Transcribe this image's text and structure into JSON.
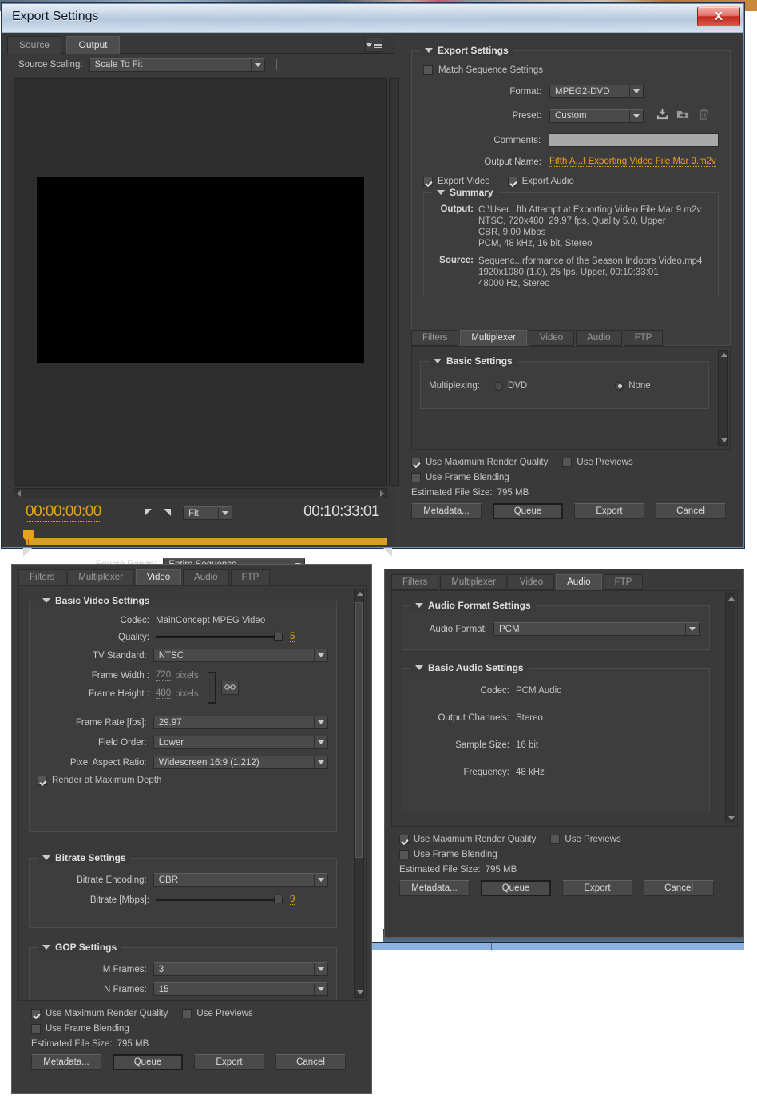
{
  "window": {
    "title": "Export Settings",
    "close_label": "X"
  },
  "left_panel": {
    "tabs": [
      {
        "label": "Source",
        "active": false
      },
      {
        "label": "Output",
        "active": true
      }
    ],
    "panel_menu_icon": "panel-menu-icon",
    "source_scaling_label": "Source Scaling:",
    "source_scaling_value": "Scale To Fit",
    "current_timecode": "00:00:00:00",
    "duration_timecode": "00:10:33:01",
    "zoom_level": "Fit",
    "source_range_label": "Source Range:",
    "source_range_value": "Entire Sequence"
  },
  "export_settings": {
    "group_title": "Export Settings",
    "match_sequence_label": "Match Sequence Settings",
    "match_sequence_checked": false,
    "format_label": "Format:",
    "format_value": "MPEG2-DVD",
    "preset_label": "Preset:",
    "preset_value": "Custom",
    "preset_icons": [
      "save-preset-icon",
      "import-preset-icon",
      "delete-preset-icon"
    ],
    "comments_label": "Comments:",
    "comments_value": "",
    "output_name_label": "Output Name:",
    "output_name_value": "Fifth A...t Exporting Video File Mar 9.m2v",
    "output_name_color": "#e8a317",
    "export_video_label": "Export Video",
    "export_video_checked": true,
    "export_audio_label": "Export Audio",
    "export_audio_checked": true
  },
  "summary": {
    "group_title": "Summary",
    "output_key": "Output:",
    "output_lines": [
      "C:\\User...fth Attempt at Exporting Video File Mar 9.m2v",
      "NTSC, 720x480, 29.97 fps, Quality 5.0, Upper",
      "CBR, 9.00 Mbps",
      "PCM, 48 kHz, 16 bit, Stereo"
    ],
    "source_key": "Source:",
    "source_lines": [
      "Sequenc...rformance of the Season Indoors Video.mp4",
      "1920x1080 (1.0), 25 fps, Upper, 00:10:33:01",
      "48000 Hz, Stereo"
    ]
  },
  "main_tabs": [
    {
      "label": "Filters",
      "active": false
    },
    {
      "label": "Multiplexer",
      "active": true
    },
    {
      "label": "Video",
      "active": false
    },
    {
      "label": "Audio",
      "active": false
    },
    {
      "label": "FTP",
      "active": false
    }
  ],
  "multiplexer": {
    "group_title": "Basic Settings",
    "multiplexing_label": "Multiplexing:",
    "option_dvd": "DVD",
    "option_dvd_selected": false,
    "option_none": "None",
    "option_none_selected": true
  },
  "footer": {
    "max_render_quality_label": "Use Maximum Render Quality",
    "max_render_quality_checked": true,
    "use_previews_label": "Use Previews",
    "use_previews_checked": false,
    "frame_blending_label": "Use Frame Blending",
    "frame_blending_checked": false,
    "estimated_size_label": "Estimated File Size:",
    "estimated_size_value": "795 MB",
    "buttons": [
      {
        "label": "Metadata...",
        "default": false
      },
      {
        "label": "Queue",
        "default": true
      },
      {
        "label": "Export",
        "default": false
      },
      {
        "label": "Cancel",
        "default": false
      }
    ]
  },
  "video_window": {
    "tabs": [
      {
        "label": "Filters",
        "active": false
      },
      {
        "label": "Multiplexer",
        "active": false
      },
      {
        "label": "Video",
        "active": true
      },
      {
        "label": "Audio",
        "active": false
      },
      {
        "label": "FTP",
        "active": false
      }
    ],
    "basic_group_title": "Basic Video Settings",
    "codec_label": "Codec:",
    "codec_value": "MainConcept MPEG Video",
    "quality_label": "Quality:",
    "quality_value": "5",
    "quality_percent": 92,
    "tv_standard_label": "TV Standard:",
    "tv_standard_value": "NTSC",
    "frame_width_label": "Frame Width :",
    "frame_width_value": "720",
    "frame_width_unit": "pixels",
    "frame_height_label": "Frame Height :",
    "frame_height_value": "480",
    "frame_height_unit": "pixels",
    "link_icon": "link-icon",
    "frame_rate_label": "Frame Rate [fps]:",
    "frame_rate_value": "29.97",
    "field_order_label": "Field Order:",
    "field_order_value": "Lower",
    "par_label": "Pixel Aspect Ratio:",
    "par_value": "Widescreen 16:9 (1.212)",
    "render_max_depth_label": "Render at Maximum Depth",
    "render_max_depth_checked": true,
    "bitrate_group_title": "Bitrate Settings",
    "bitrate_encoding_label": "Bitrate Encoding:",
    "bitrate_encoding_value": "CBR",
    "bitrate_label": "Bitrate [Mbps]:",
    "bitrate_value": "9",
    "bitrate_percent": 92,
    "gop_group_title": "GOP Settings",
    "m_frames_label": "M Frames:",
    "m_frames_value": "3",
    "n_frames_label": "N Frames:",
    "n_frames_value": "15"
  },
  "audio_window": {
    "tabs": [
      {
        "label": "Filters",
        "active": false
      },
      {
        "label": "Multiplexer",
        "active": false
      },
      {
        "label": "Video",
        "active": false
      },
      {
        "label": "Audio",
        "active": true
      },
      {
        "label": "FTP",
        "active": false
      }
    ],
    "format_group_title": "Audio Format Settings",
    "audio_format_label": "Audio Format:",
    "audio_format_value": "PCM",
    "basic_group_title": "Basic Audio Settings",
    "codec_label": "Codec:",
    "codec_value": "PCM Audio",
    "output_channels_label": "Output Channels:",
    "output_channels_value": "Stereo",
    "sample_size_label": "Sample Size:",
    "sample_size_value": "16 bit",
    "frequency_label": "Frequency:",
    "frequency_value": "48 kHz"
  }
}
